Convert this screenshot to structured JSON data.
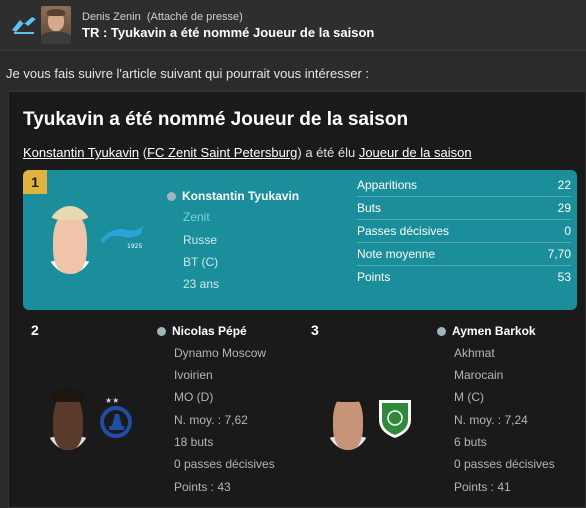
{
  "header": {
    "sender_name": "Denis Zenin",
    "sender_role": "(Attaché de presse)",
    "subject": "TR : Tyukavin a été nommé Joueur de la saison"
  },
  "intro": "Je vous fais suivre l'article suivant qui pourrait vous intéresser :",
  "article": {
    "title": "Tyukavin a été nommé Joueur de la saison",
    "line": {
      "player_link": "Konstantin Tyukavin",
      "open_paren": " (",
      "club_link": "FC Zenit Saint Petersburg",
      "middle": ") a été élu ",
      "award_link": "Joueur de la saison"
    }
  },
  "winner": {
    "rank": "1",
    "name": "Konstantin Tyukavin",
    "club": "Zenit",
    "nationality": "Russe",
    "position": "BT (C)",
    "age": "23 ans",
    "stats": [
      {
        "label": "Apparitions",
        "value": "22"
      },
      {
        "label": "Buts",
        "value": "29"
      },
      {
        "label": "Passes décisives",
        "value": "0"
      },
      {
        "label": "Note moyenne",
        "value": "7,70"
      },
      {
        "label": "Points",
        "value": "53"
      }
    ]
  },
  "runners": [
    {
      "rank": "2",
      "name": "Nicolas Pépé",
      "lines": [
        "Dynamo Moscow",
        "Ivoirien",
        "MO (D)",
        "N. moy. : 7,62",
        "18 buts",
        "0 passes décisives",
        "Points : 43"
      ]
    },
    {
      "rank": "3",
      "name": "Aymen Barkok",
      "lines": [
        "Akhmat",
        "Marocain",
        "M (C)",
        "N. moy. : 7,24",
        "6 buts",
        "0 passes décisives",
        "Points : 41"
      ]
    }
  ],
  "colors": {
    "winner_card": "#1a8f9b",
    "rank_badge": "#e0b43a",
    "zenit_blue": "#2aa3d8",
    "dynamo_blue": "#1d4fa8",
    "akhmat_green": "#2f8a3c"
  },
  "icons": {
    "club_logo": "zenit-logo",
    "person": "person-icon"
  }
}
